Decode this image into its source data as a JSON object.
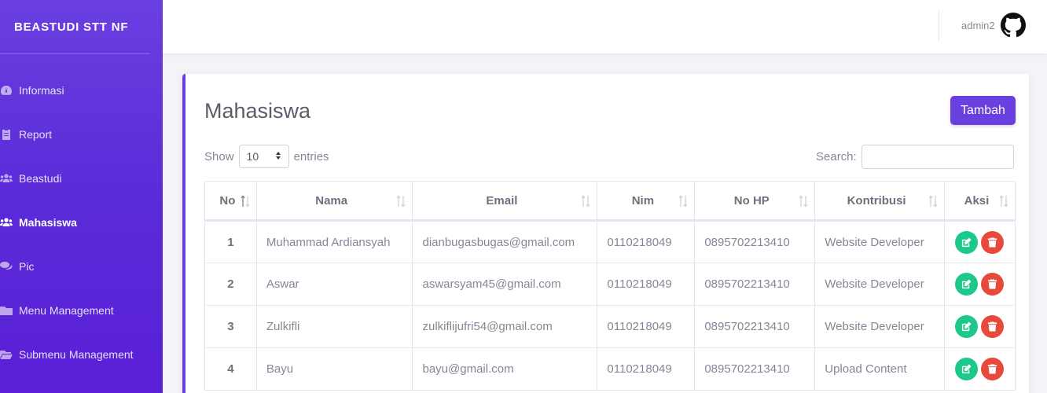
{
  "brand": "BEASTUDI STT NF",
  "sidebar": {
    "items": [
      {
        "label": "Informasi",
        "icon": "dashboard-icon",
        "active": false
      },
      {
        "label": "Report",
        "icon": "clipboard-icon",
        "active": false
      },
      {
        "label": "Beastudi",
        "icon": "users-icon",
        "active": false
      },
      {
        "label": "Mahasiswa",
        "icon": "users-icon",
        "active": true
      },
      {
        "label": "Pic",
        "icon": "comments-icon",
        "active": false
      },
      {
        "label": "Menu Management",
        "icon": "folder-icon",
        "active": false
      },
      {
        "label": "Submenu Management",
        "icon": "folder-open-icon",
        "active": false
      }
    ]
  },
  "topbar": {
    "user_name": "admin2",
    "avatar_icon": "github-icon"
  },
  "card": {
    "title": "Mahasiswa",
    "add_button": "Tambah"
  },
  "table_controls": {
    "show_label": "Show",
    "entries_value": "10",
    "entries_label": "entries",
    "search_label": "Search:"
  },
  "table": {
    "headers": [
      "No",
      "Nama",
      "Email",
      "Nim",
      "No HP",
      "Kontribusi",
      "Aksi"
    ],
    "rows": [
      {
        "no": "1",
        "nama": "Muhammad Ardiansyah",
        "email": "dianbugasbugas@gmail.com",
        "nim": "0110218049",
        "hp": "0895702213410",
        "kontribusi": "Website Developer"
      },
      {
        "no": "2",
        "nama": "Aswar",
        "email": "aswarsyam45@gmail.com",
        "nim": "0110218049",
        "hp": "0895702213410",
        "kontribusi": "Website Developer"
      },
      {
        "no": "3",
        "nama": "Zulkifli",
        "email": "zulkiflijufri54@gmail.com",
        "nim": "0110218049",
        "hp": "0895702213410",
        "kontribusi": "Website Developer"
      },
      {
        "no": "4",
        "nama": "Bayu",
        "email": "bayu@gmail.com",
        "nim": "0110218049",
        "hp": "0895702213410",
        "kontribusi": "Upload Content"
      }
    ]
  },
  "colors": {
    "primary": "#6a3fe0",
    "success": "#1cc88a",
    "danger": "#e74a3b"
  }
}
